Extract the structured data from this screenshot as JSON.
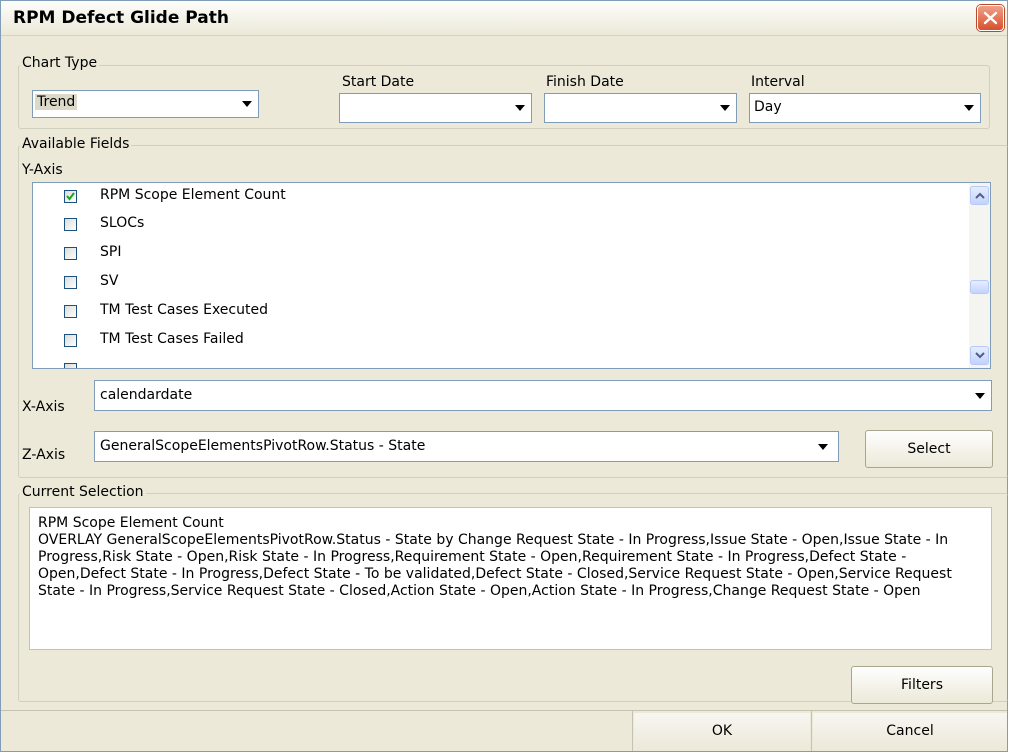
{
  "window": {
    "title": "RPM Defect Glide Path"
  },
  "chart_type": {
    "legend": "Chart Type",
    "value": "Trend"
  },
  "start_date": {
    "label": "Start Date",
    "value": ""
  },
  "finish_date": {
    "label": "Finish Date",
    "value": ""
  },
  "interval": {
    "label": "Interval",
    "value": "Day"
  },
  "available_fields": {
    "legend": "Available Fields",
    "y_axis_label": "Y-Axis",
    "items": [
      {
        "label": "RPM Scope Element Count",
        "checked": true
      },
      {
        "label": "SLOCs",
        "checked": false
      },
      {
        "label": "SPI",
        "checked": false
      },
      {
        "label": "SV",
        "checked": false
      },
      {
        "label": "TM Test Cases Executed",
        "checked": false
      },
      {
        "label": "TM Test Cases Failed",
        "checked": false
      }
    ],
    "x_axis_label": "X-Axis",
    "x_axis_value": "calendardate",
    "z_axis_label": "Z-Axis",
    "z_axis_value": "GeneralScopeElementsPivotRow.Status - State",
    "select_button": "Select"
  },
  "current_selection": {
    "legend": "Current Selection",
    "text": "RPM Scope Element Count\nOVERLAY GeneralScopeElementsPivotRow.Status - State by Change Request State - In Progress,Issue State - Open,Issue State - In Progress,Risk State - Open,Risk State - In Progress,Requirement State - Open,Requirement State - In Progress,Defect State - Open,Defect State - In Progress,Defect State - To be validated,Defect State - Closed,Service Request State - Open,Service Request State - In Progress,Service Request State - Closed,Action State - Open,Action State - In Progress,Change Request State - Open"
  },
  "buttons": {
    "filters": "Filters",
    "ok": "OK",
    "cancel": "Cancel"
  },
  "icons": {
    "close": "close-icon",
    "check": "checkmark-icon",
    "scroll_up": "chevron-up-icon",
    "scroll_down": "chevron-down-icon",
    "dropdown": "dropdown-arrow-icon"
  },
  "colors": {
    "close_button": "#d8502c",
    "window_bg": "#ece9d8",
    "checkmark": "#21a121"
  }
}
